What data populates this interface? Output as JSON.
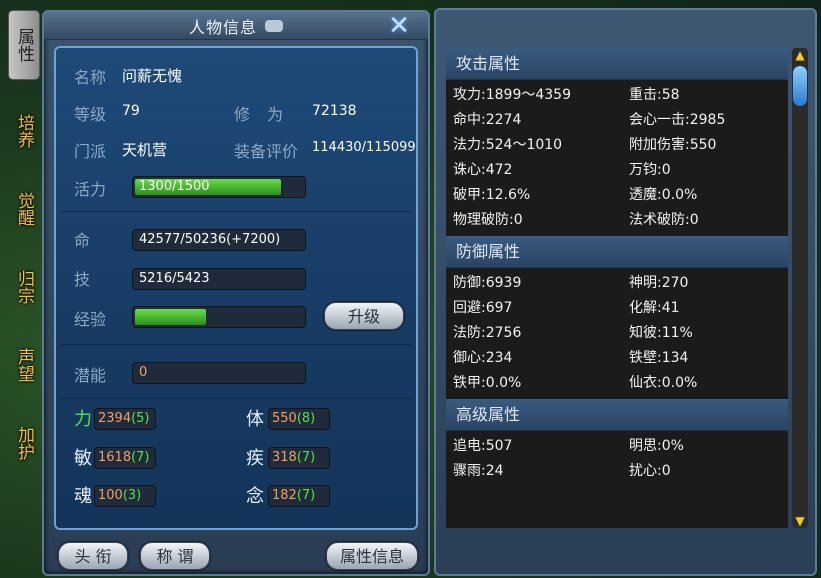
{
  "side_tabs": [
    "属性",
    "培养",
    "觉醒",
    "归宗",
    "声望",
    "加护"
  ],
  "panel": {
    "title": "人物信息"
  },
  "character": {
    "name_label": "名称",
    "name": "问薪无愧",
    "level_label": "等级",
    "level": "79",
    "cultivation_label": "修 为",
    "cultivation": "72138",
    "sect_label": "门派",
    "sect": "天机营",
    "equip_label": "装备评价",
    "equip_score": "114430/115099"
  },
  "vitality": {
    "label": "活力",
    "text": "1300/1500",
    "value": 0.867
  },
  "hp": {
    "label": "命",
    "text": "42577/50236(+7200)"
  },
  "skill": {
    "label": "技",
    "text": "5216/5423"
  },
  "exp": {
    "label": "经验",
    "value": 0.42
  },
  "level_up_button": "升级",
  "potential": {
    "label": "潜能",
    "value": "0"
  },
  "stats": [
    {
      "name": "力",
      "value": "2394",
      "bonus": "(5)"
    },
    {
      "name": "体",
      "value": "550",
      "bonus": "(8)"
    },
    {
      "name": "敏",
      "value": "1618",
      "bonus": "(7)"
    },
    {
      "name": "疾",
      "value": "318",
      "bonus": "(7)"
    },
    {
      "name": "魂",
      "value": "100",
      "bonus": "(3)"
    },
    {
      "name": "念",
      "value": "182",
      "bonus": "(7)"
    }
  ],
  "bottom_buttons": [
    "头 衔",
    "称 谓",
    "属性信息"
  ],
  "sections": [
    {
      "title": "攻击属性",
      "items": [
        "攻力:1899～4359",
        "重击:58",
        "命中:2274",
        "会心一击:2985",
        "法力:524～1010",
        "附加伤害:550",
        "诛心:472",
        "万钧:0",
        "破甲:12.6%",
        "透魔:0.0%",
        "物理破防:0",
        "法术破防:0"
      ]
    },
    {
      "title": "防御属性",
      "items": [
        "防御:6939",
        "神明:270",
        "回避:697",
        "化解:41",
        "法防:2756",
        "知彼:11%",
        "御心:234",
        "铁壁:134",
        "铁甲:0.0%",
        "仙衣:0.0%"
      ]
    },
    {
      "title": "高级属性",
      "items": [
        "追电:507",
        "明思:0%",
        "骤雨:24",
        "扰心:0"
      ]
    }
  ],
  "colors": {
    "bar_green": "#4cc832",
    "stat_orange": "#f0a060",
    "stat_bonus_green": "#57e04a",
    "tab_gold": "#f0c040"
  }
}
